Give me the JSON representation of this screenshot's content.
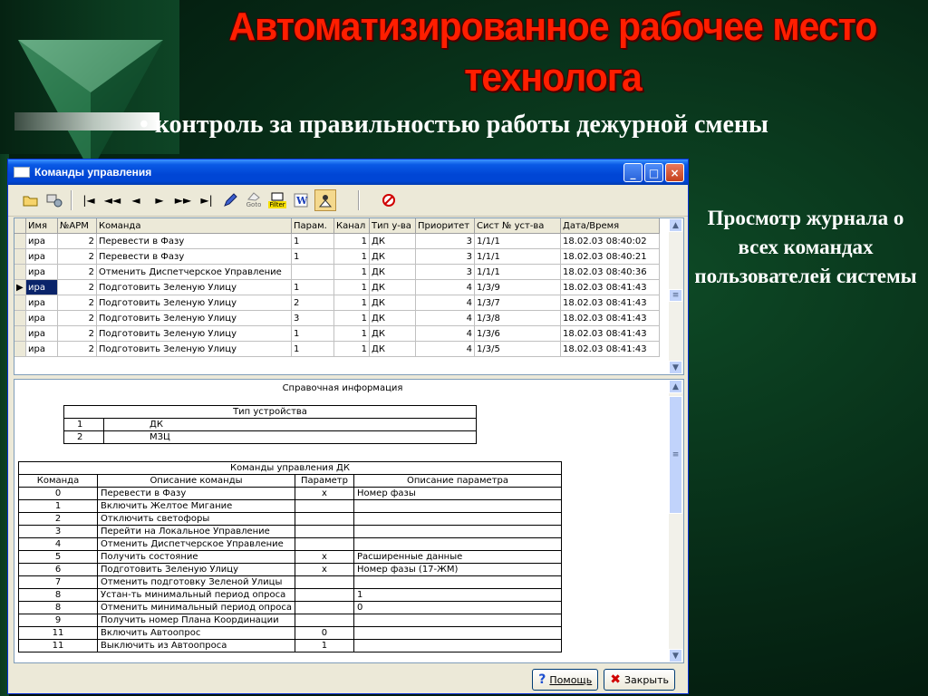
{
  "slide": {
    "title_line1": "Автоматизированное рабочее место",
    "title_line2": "технолога",
    "bullet_mark": "•",
    "bullet_text": "контроль за правильностью работы дежурной смены",
    "side_caption": "Просмотр журнала о всех командах пользователей системы",
    "colors": {
      "title": "#ff1e00",
      "background": "#062815"
    }
  },
  "window": {
    "title": "Команды управления",
    "controls": {
      "minimize": "_",
      "maximize": "□",
      "close": "×"
    },
    "toolbar": {
      "open_icon": "folder-open-icon",
      "settings_icon": "settings-icon",
      "nav_first": "|◄",
      "nav_prev_page": "◄◄",
      "nav_prev": "◄",
      "nav_next": "►",
      "nav_next_page": "►►",
      "nav_last": "►|",
      "goto_label": "Goto",
      "filter_label": "Filter",
      "stop_icon": "stop-icon"
    },
    "grid": {
      "columns": [
        "Имя",
        "№АРМ",
        "Команда",
        "Парам.",
        "Канал",
        "Тип у-ва",
        "Приоритет",
        "Сист № уст-ва",
        "Дата/Время"
      ],
      "rows": [
        [
          "ира",
          "2",
          "Перевести в Фазу",
          "1",
          "1",
          "ДК",
          "3",
          "1/1/1",
          "18.02.03 08:40:02"
        ],
        [
          "ира",
          "2",
          "Перевести в Фазу",
          "1",
          "1",
          "ДК",
          "3",
          "1/1/1",
          "18.02.03 08:40:21"
        ],
        [
          "ира",
          "2",
          "Отменить Диспетчерское Управление",
          "",
          "1",
          "ДК",
          "3",
          "1/1/1",
          "18.02.03 08:40:36"
        ],
        [
          "ира",
          "2",
          "Подготовить Зеленую Улицу",
          "1",
          "1",
          "ДК",
          "4",
          "1/3/9",
          "18.02.03 08:41:43"
        ],
        [
          "ира",
          "2",
          "Подготовить Зеленую Улицу",
          "2",
          "1",
          "ДК",
          "4",
          "1/3/7",
          "18.02.03 08:41:43"
        ],
        [
          "ира",
          "2",
          "Подготовить Зеленую Улицу",
          "3",
          "1",
          "ДК",
          "4",
          "1/3/8",
          "18.02.03 08:41:43"
        ],
        [
          "ира",
          "2",
          "Подготовить Зеленую Улицу",
          "1",
          "1",
          "ДК",
          "4",
          "1/3/6",
          "18.02.03 08:41:43"
        ],
        [
          "ира",
          "2",
          "Подготовить Зеленую Улицу",
          "1",
          "1",
          "ДК",
          "4",
          "1/3/5",
          "18.02.03 08:41:43"
        ]
      ],
      "selected_row": 3
    },
    "reference": {
      "title": "Справочная информация",
      "device_types": {
        "header": "Тип устройства",
        "rows": [
          [
            "1",
            "ДК"
          ],
          [
            "2",
            "МЗЦ"
          ]
        ]
      },
      "commands": {
        "header": "Команды управления ДК",
        "columns": [
          "Команда",
          "Описание команды",
          "Параметр",
          "Описание параметра"
        ],
        "rows": [
          [
            "0",
            "Перевести в Фазу",
            "х",
            "Номер фазы"
          ],
          [
            "1",
            "Включить Желтое Мигание",
            "",
            ""
          ],
          [
            "2",
            "Отключить светофоры",
            "",
            ""
          ],
          [
            "3",
            "Перейти на Локальное Управление",
            "",
            ""
          ],
          [
            "4",
            "Отменить Диспетчерское Управление",
            "",
            ""
          ],
          [
            "5",
            "Получить состояние",
            "х",
            "Расширенные данные"
          ],
          [
            "6",
            "Подготовить Зеленую Улицу",
            "х",
            "Номер фазы   (17-ЖМ)"
          ],
          [
            "7",
            "Отменить подготовку Зеленой Улицы",
            "",
            ""
          ],
          [
            "8",
            "Устан-ть минимальный период опроса",
            "",
            "1"
          ],
          [
            "8",
            "Отменить минимальный период опроса",
            "",
            "0"
          ],
          [
            "9",
            "Получить номер Плана Координации",
            "",
            ""
          ],
          [
            "11",
            "Включить Автоопрос",
            "0",
            ""
          ],
          [
            "11",
            "Выключить из Автоопроса",
            "1",
            ""
          ]
        ]
      }
    },
    "buttons": {
      "help": "Помощь",
      "close": "Закрыть"
    }
  }
}
